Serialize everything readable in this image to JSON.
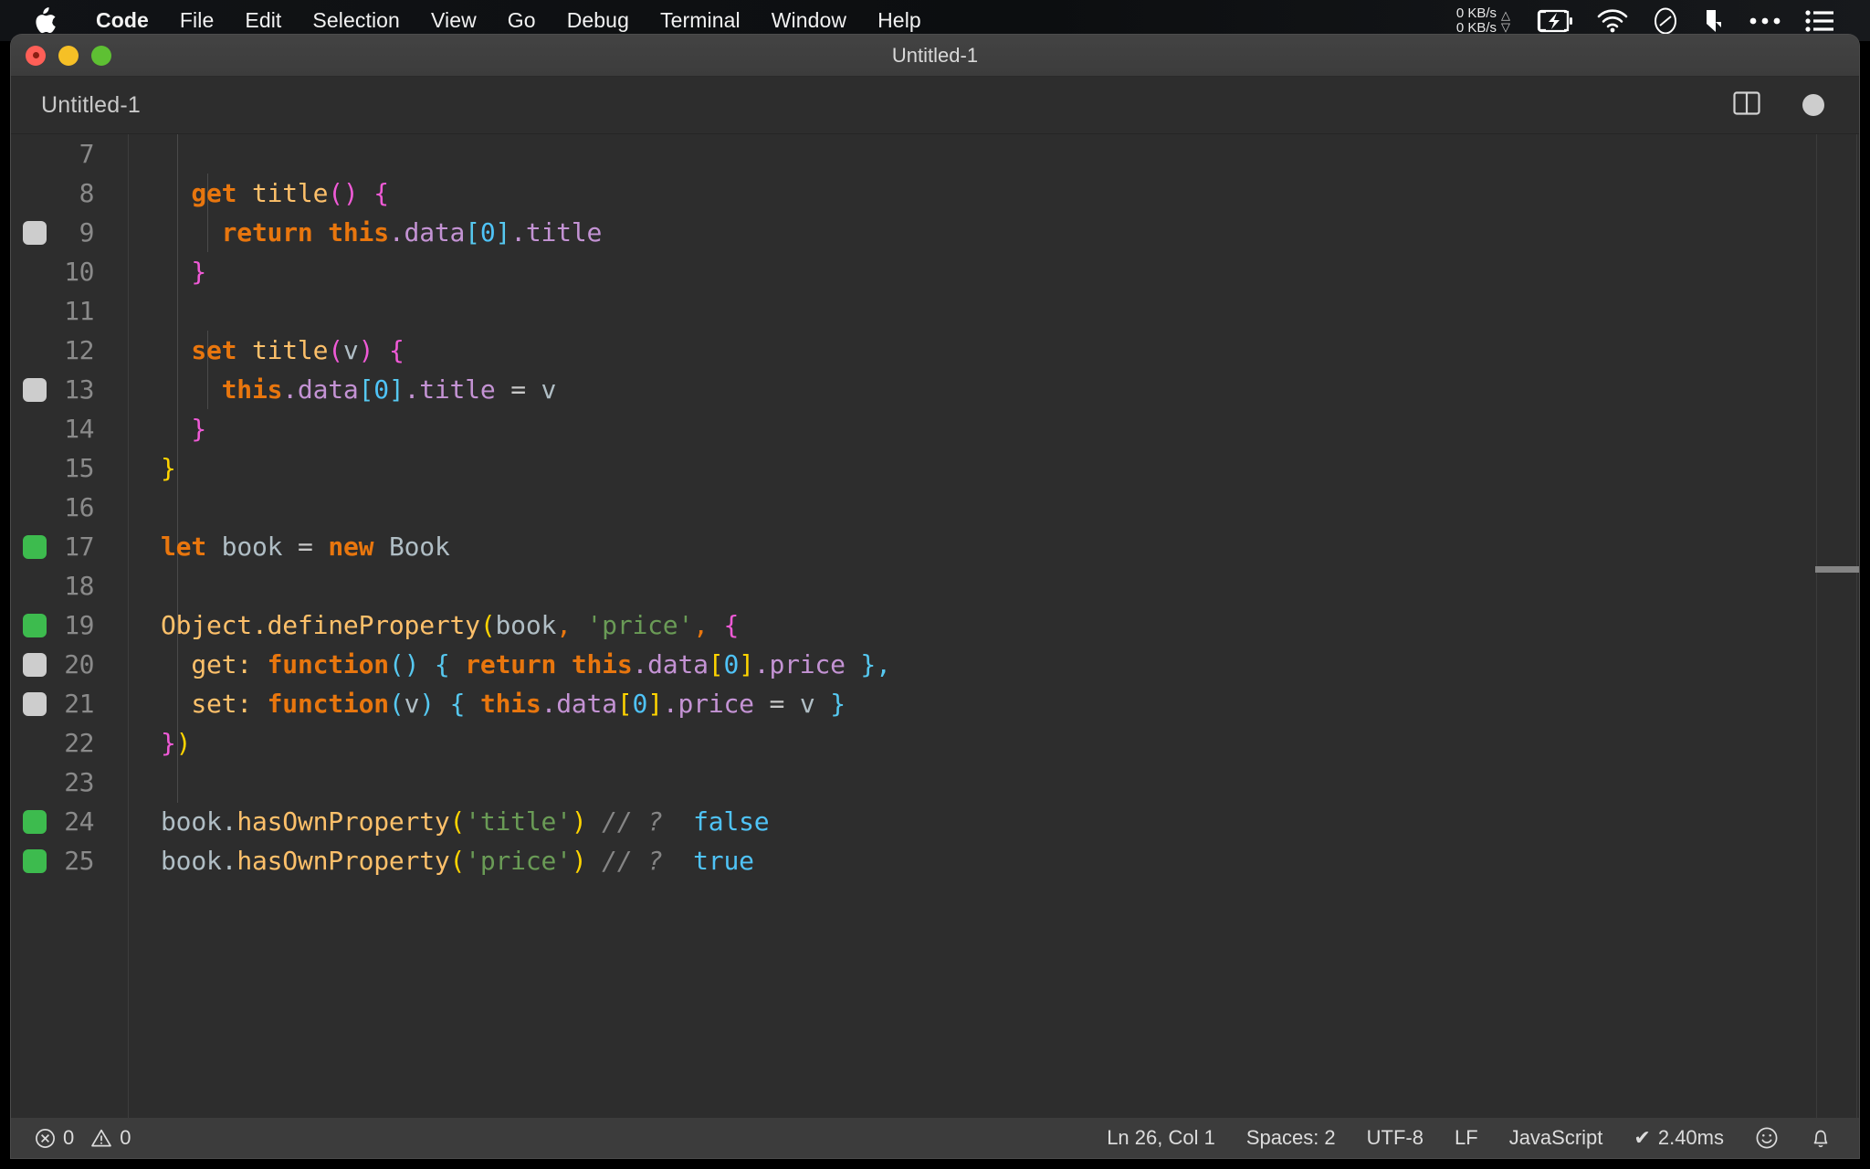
{
  "menubar": {
    "apple_icon": "apple-logo",
    "items": [
      {
        "label": "Code",
        "bold": true
      },
      {
        "label": "File",
        "bold": false
      },
      {
        "label": "Edit",
        "bold": false
      },
      {
        "label": "Selection",
        "bold": false
      },
      {
        "label": "View",
        "bold": false
      },
      {
        "label": "Go",
        "bold": false
      },
      {
        "label": "Debug",
        "bold": false
      },
      {
        "label": "Terminal",
        "bold": false
      },
      {
        "label": "Window",
        "bold": false
      },
      {
        "label": "Help",
        "bold": false
      }
    ],
    "network": {
      "up": "0 KB/s",
      "down": "0 KB/s",
      "up_arrow": "△",
      "down_arrow": "▽"
    },
    "tray_icons": [
      "battery-charging-icon",
      "wifi-icon",
      "do-not-disturb-icon",
      "dropbox-icon",
      "ellipsis-icon",
      "list-icon"
    ]
  },
  "window": {
    "title": "Untitled-1",
    "traffic_lights": [
      "close-button",
      "minimize-button",
      "zoom-button"
    ]
  },
  "tabstrip": {
    "tab_label": "Untitled-1",
    "split_editor_icon": "split-editor-icon",
    "unsaved_indicator": "unsaved-dot"
  },
  "editor": {
    "language": "JavaScript",
    "first_visible_line": 7,
    "lines": [
      {
        "n": "7",
        "marker": "none"
      },
      {
        "n": "8",
        "marker": "none"
      },
      {
        "n": "9",
        "marker": "grey"
      },
      {
        "n": "10",
        "marker": "none"
      },
      {
        "n": "11",
        "marker": "none"
      },
      {
        "n": "12",
        "marker": "none"
      },
      {
        "n": "13",
        "marker": "grey"
      },
      {
        "n": "14",
        "marker": "none"
      },
      {
        "n": "15",
        "marker": "none"
      },
      {
        "n": "16",
        "marker": "none"
      },
      {
        "n": "17",
        "marker": "green"
      },
      {
        "n": "18",
        "marker": "none"
      },
      {
        "n": "19",
        "marker": "green"
      },
      {
        "n": "20",
        "marker": "grey"
      },
      {
        "n": "21",
        "marker": "grey"
      },
      {
        "n": "22",
        "marker": "none"
      },
      {
        "n": "23",
        "marker": "none"
      },
      {
        "n": "24",
        "marker": "green"
      },
      {
        "n": "25",
        "marker": "green"
      }
    ],
    "source_text": [
      "",
      "  get title() {",
      "    return this.data[0].title",
      "  }",
      "",
      "  set title(v) {",
      "    this.data[0].title = v",
      "  }",
      "}",
      "",
      "let book = new Book",
      "",
      "Object.defineProperty(book, 'price', {",
      "  get: function() { return this.data[0].price },",
      "  set: function(v) { this.data[0].price = v }",
      "})",
      "",
      "book.hasOwnProperty('title') // ?  false",
      "book.hasOwnProperty('price') // ?  true"
    ]
  },
  "statusbar": {
    "errors_icon": "error-circle-icon",
    "errors": "0",
    "warnings_icon": "warning-triangle-icon",
    "warnings": "0",
    "cursor_position": "Ln 26, Col 1",
    "indentation": "Spaces: 2",
    "encoding": "UTF-8",
    "eol": "LF",
    "language_mode": "JavaScript",
    "runtime_check": "✔",
    "runtime": "2.40ms",
    "feedback_icon": "smiley-icon",
    "notifications_icon": "bell-icon"
  },
  "colors": {
    "editor_bg": "#2d2d2d",
    "statusbar_bg": "#3c3c3c",
    "titlebar_bg": "#3f3f3f",
    "keyword": "#e8760e",
    "function": "#fdc06a",
    "property": "#c493d4",
    "string": "#6a9b56",
    "number": "#4fc3f7",
    "comment": "#858585",
    "added_marker": "#3dbb4e",
    "modified_marker": "#cdcdcd"
  }
}
